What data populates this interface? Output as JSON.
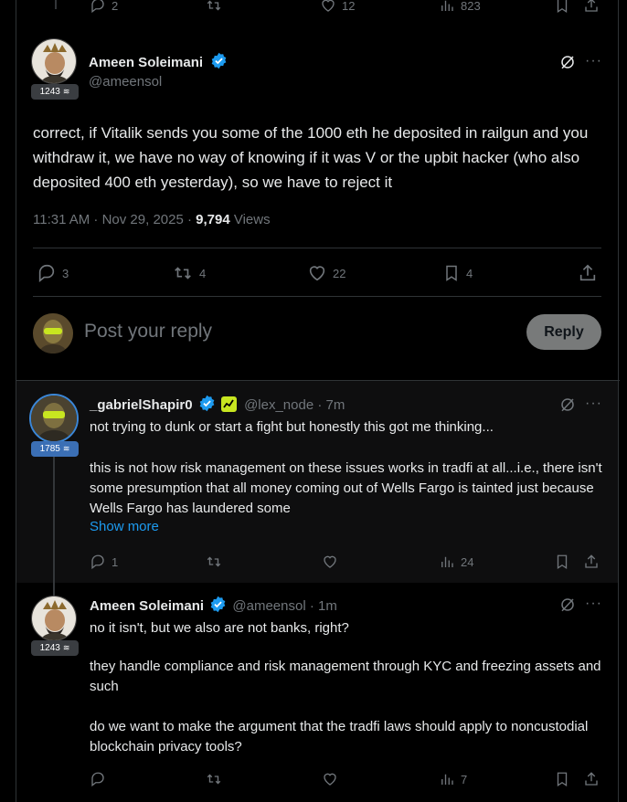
{
  "top_actions": {
    "replies": "2",
    "likes": "12",
    "views": "823"
  },
  "main_post": {
    "name": "Ameen Soleimani",
    "handle": "@ameensol",
    "badge": "1243",
    "text": "correct, if Vitalik sends you some of the 1000 eth he deposited in railgun and you withdraw it, we have no way of knowing if it was V or the upbit hacker (who also deposited 400 eth yesterday),  so we have to reject it",
    "time": "11:31 AM · Nov 29, 2025 · ",
    "views_count": "9,794",
    "views_label": " Views",
    "replies": "3",
    "reposts": "4",
    "likes": "22",
    "bookmarks": "4"
  },
  "compose": {
    "placeholder": "Post your reply",
    "button": "Reply"
  },
  "reply1": {
    "name": "_gabrielShapir0",
    "handle": "@lex_node",
    "time": "· 7m",
    "badge": "1785",
    "line1": "not trying to dunk or start a fight but honestly this got me thinking...",
    "para2": "this is not how risk management on these issues works in tradfi at all...i.e., there isn't some presumption that all money coming out of Wells Fargo is tainted just because Wells Fargo has laundered some",
    "show_more": "Show more",
    "replies": "1",
    "views": "24"
  },
  "reply2": {
    "name": "Ameen Soleimani",
    "handle": "@ameensol",
    "time": "· 1m",
    "badge": "1243",
    "p1": "no it isn't,  but we also are not banks, right?",
    "p2": "they handle compliance and risk management through KYC and freezing assets and such",
    "p3": "do we want to make the argument that the tradfi laws should apply to noncustodial blockchain privacy tools?",
    "views": "7"
  },
  "colors": {
    "background": "#000000",
    "text": "#e7e9ea",
    "muted": "#71767b",
    "accent": "#1d9bf0",
    "badge_blue": "#3b6fb5",
    "badge_gray": "#3a3d41",
    "highlight_bg": "#0e0e0f"
  }
}
